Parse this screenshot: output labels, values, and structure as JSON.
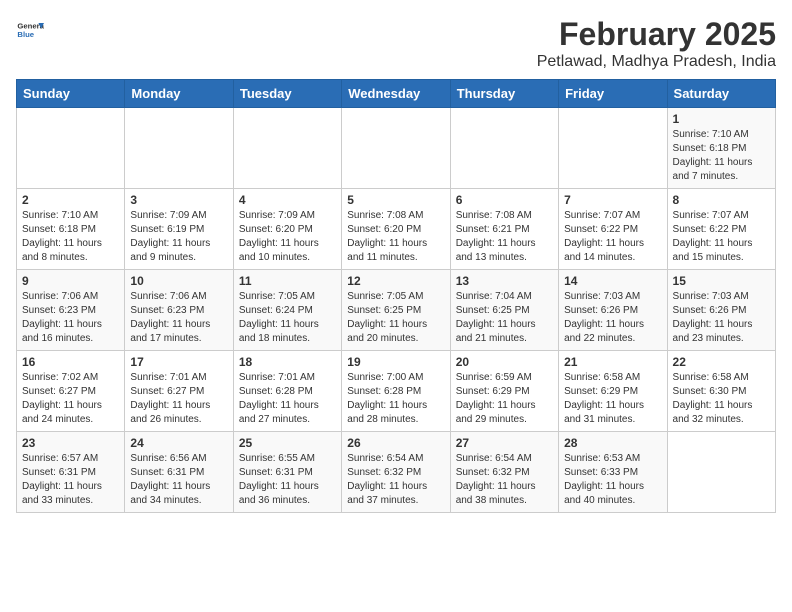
{
  "logo": {
    "general": "General",
    "blue": "Blue"
  },
  "title": "February 2025",
  "subtitle": "Petlawad, Madhya Pradesh, India",
  "days_of_week": [
    "Sunday",
    "Monday",
    "Tuesday",
    "Wednesday",
    "Thursday",
    "Friday",
    "Saturday"
  ],
  "weeks": [
    [
      {
        "day": "",
        "info": ""
      },
      {
        "day": "",
        "info": ""
      },
      {
        "day": "",
        "info": ""
      },
      {
        "day": "",
        "info": ""
      },
      {
        "day": "",
        "info": ""
      },
      {
        "day": "",
        "info": ""
      },
      {
        "day": "1",
        "info": "Sunrise: 7:10 AM\nSunset: 6:18 PM\nDaylight: 11 hours\nand 7 minutes."
      }
    ],
    [
      {
        "day": "2",
        "info": "Sunrise: 7:10 AM\nSunset: 6:18 PM\nDaylight: 11 hours\nand 8 minutes."
      },
      {
        "day": "3",
        "info": "Sunrise: 7:09 AM\nSunset: 6:19 PM\nDaylight: 11 hours\nand 9 minutes."
      },
      {
        "day": "4",
        "info": "Sunrise: 7:09 AM\nSunset: 6:20 PM\nDaylight: 11 hours\nand 10 minutes."
      },
      {
        "day": "5",
        "info": "Sunrise: 7:08 AM\nSunset: 6:20 PM\nDaylight: 11 hours\nand 11 minutes."
      },
      {
        "day": "6",
        "info": "Sunrise: 7:08 AM\nSunset: 6:21 PM\nDaylight: 11 hours\nand 13 minutes."
      },
      {
        "day": "7",
        "info": "Sunrise: 7:07 AM\nSunset: 6:22 PM\nDaylight: 11 hours\nand 14 minutes."
      },
      {
        "day": "8",
        "info": "Sunrise: 7:07 AM\nSunset: 6:22 PM\nDaylight: 11 hours\nand 15 minutes."
      }
    ],
    [
      {
        "day": "9",
        "info": "Sunrise: 7:06 AM\nSunset: 6:23 PM\nDaylight: 11 hours\nand 16 minutes."
      },
      {
        "day": "10",
        "info": "Sunrise: 7:06 AM\nSunset: 6:23 PM\nDaylight: 11 hours\nand 17 minutes."
      },
      {
        "day": "11",
        "info": "Sunrise: 7:05 AM\nSunset: 6:24 PM\nDaylight: 11 hours\nand 18 minutes."
      },
      {
        "day": "12",
        "info": "Sunrise: 7:05 AM\nSunset: 6:25 PM\nDaylight: 11 hours\nand 20 minutes."
      },
      {
        "day": "13",
        "info": "Sunrise: 7:04 AM\nSunset: 6:25 PM\nDaylight: 11 hours\nand 21 minutes."
      },
      {
        "day": "14",
        "info": "Sunrise: 7:03 AM\nSunset: 6:26 PM\nDaylight: 11 hours\nand 22 minutes."
      },
      {
        "day": "15",
        "info": "Sunrise: 7:03 AM\nSunset: 6:26 PM\nDaylight: 11 hours\nand 23 minutes."
      }
    ],
    [
      {
        "day": "16",
        "info": "Sunrise: 7:02 AM\nSunset: 6:27 PM\nDaylight: 11 hours\nand 24 minutes."
      },
      {
        "day": "17",
        "info": "Sunrise: 7:01 AM\nSunset: 6:27 PM\nDaylight: 11 hours\nand 26 minutes."
      },
      {
        "day": "18",
        "info": "Sunrise: 7:01 AM\nSunset: 6:28 PM\nDaylight: 11 hours\nand 27 minutes."
      },
      {
        "day": "19",
        "info": "Sunrise: 7:00 AM\nSunset: 6:28 PM\nDaylight: 11 hours\nand 28 minutes."
      },
      {
        "day": "20",
        "info": "Sunrise: 6:59 AM\nSunset: 6:29 PM\nDaylight: 11 hours\nand 29 minutes."
      },
      {
        "day": "21",
        "info": "Sunrise: 6:58 AM\nSunset: 6:29 PM\nDaylight: 11 hours\nand 31 minutes."
      },
      {
        "day": "22",
        "info": "Sunrise: 6:58 AM\nSunset: 6:30 PM\nDaylight: 11 hours\nand 32 minutes."
      }
    ],
    [
      {
        "day": "23",
        "info": "Sunrise: 6:57 AM\nSunset: 6:31 PM\nDaylight: 11 hours\nand 33 minutes."
      },
      {
        "day": "24",
        "info": "Sunrise: 6:56 AM\nSunset: 6:31 PM\nDaylight: 11 hours\nand 34 minutes."
      },
      {
        "day": "25",
        "info": "Sunrise: 6:55 AM\nSunset: 6:31 PM\nDaylight: 11 hours\nand 36 minutes."
      },
      {
        "day": "26",
        "info": "Sunrise: 6:54 AM\nSunset: 6:32 PM\nDaylight: 11 hours\nand 37 minutes."
      },
      {
        "day": "27",
        "info": "Sunrise: 6:54 AM\nSunset: 6:32 PM\nDaylight: 11 hours\nand 38 minutes."
      },
      {
        "day": "28",
        "info": "Sunrise: 6:53 AM\nSunset: 6:33 PM\nDaylight: 11 hours\nand 40 minutes."
      },
      {
        "day": "",
        "info": ""
      }
    ]
  ]
}
